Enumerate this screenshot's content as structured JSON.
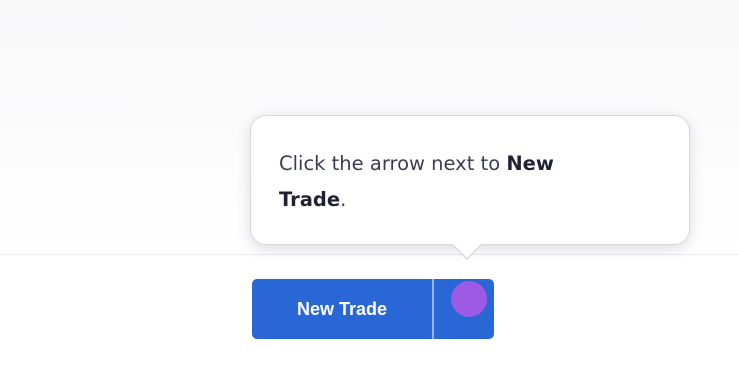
{
  "tooltip": {
    "prefix": "Click the arrow next to ",
    "emphasis_line1": "New",
    "emphasis_line2": "Trade",
    "suffix": "."
  },
  "split_button": {
    "label": "New Trade",
    "color": "#2a67d6"
  },
  "click_indicator": {
    "color": "#a35ae6"
  }
}
